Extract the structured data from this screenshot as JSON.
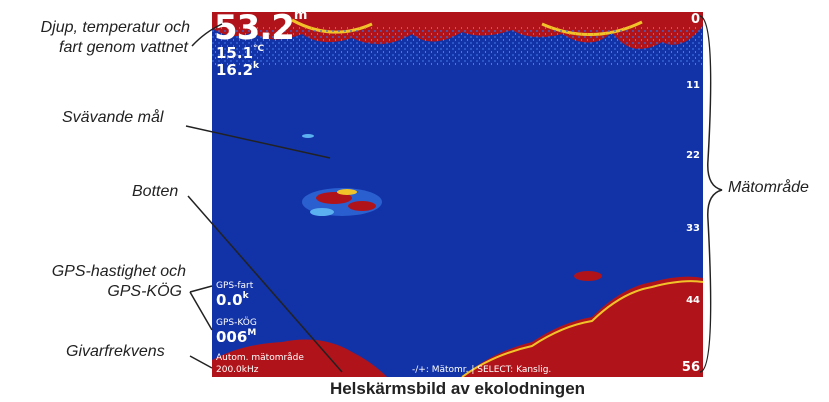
{
  "callouts": {
    "depth_line1": "Djup, temperatur och",
    "depth_line2": "fart genom vattnet",
    "suspended": "Svävande mål",
    "bottom": "Botten",
    "gps_line1": "GPS-hastighet och",
    "gps_line2": "GPS-KÖG",
    "frequency": "Givarfrekvens",
    "range": "Mätområde"
  },
  "caption": "Helskärmsbild av ekolodningen",
  "screen": {
    "depth_value": "53.2",
    "depth_unit": "m",
    "temp_value": "15.1",
    "temp_unit": "°C",
    "speed_value": "16.2",
    "speed_unit": "k",
    "gps_speed_label": "GPS-fart",
    "gps_speed_value": "0.0",
    "gps_speed_unit": "k",
    "gps_cog_label": "GPS-KÖG",
    "gps_cog_value": "006",
    "gps_cog_unit": "M",
    "range_mode": "Autom. mätområde",
    "frequency": "200.0kHz",
    "hint": "-/+: Mätomr. | SELECT: Kanslig.",
    "scale": [
      "0",
      "11",
      "22",
      "33",
      "44",
      "56"
    ]
  },
  "colors": {
    "water": "#1233a8",
    "echo_red": "#b0141a",
    "echo_yellow": "#f2c22a"
  }
}
